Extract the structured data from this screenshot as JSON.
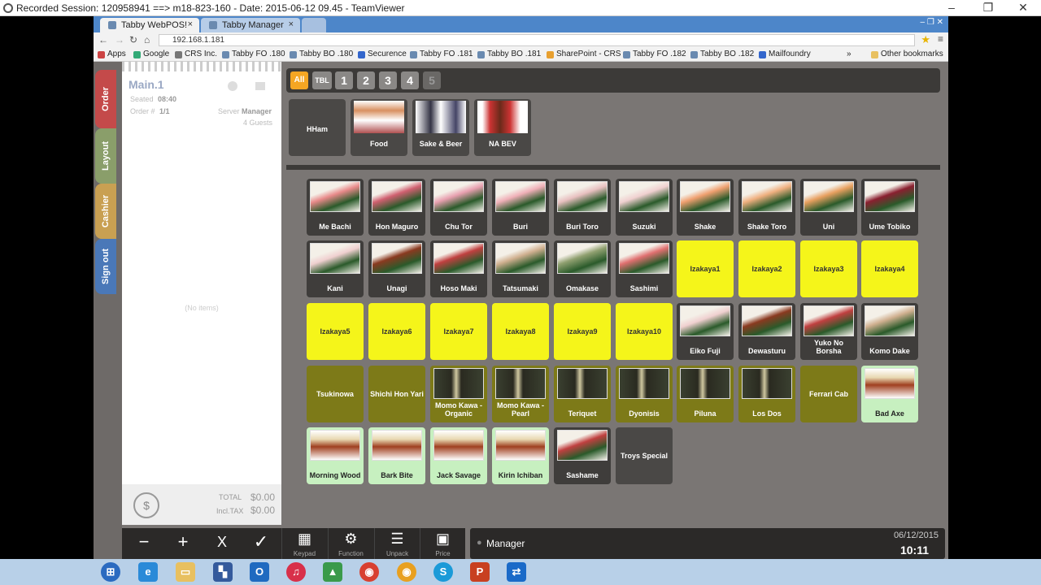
{
  "teamviewer": {
    "title": "Recorded Session: 120958941 ==> m18-823-160 - Date: 2015-06-12 09.45 - TeamViewer"
  },
  "browser": {
    "tabs": [
      {
        "label": "Tabby WebPOS!"
      },
      {
        "label": "Tabby Manager"
      }
    ],
    "url": "192.168.1.181",
    "bookmarks": [
      "Apps",
      "Google",
      "CRS Inc.",
      "Tabby FO .180",
      "Tabby BO .180",
      "Securence",
      "Tabby FO .181",
      "Tabby BO .181",
      "SharePoint - CRS",
      "Tabby FO .182",
      "Tabby BO .182",
      "Mailfoundry"
    ],
    "more_bookmarks": "»",
    "other_bookmarks": "Other bookmarks"
  },
  "sidebar": {
    "tabs": [
      {
        "label": "Order",
        "color": "#c44a4a"
      },
      {
        "label": "Layout",
        "color": "#8a9e6a"
      },
      {
        "label": "Cashier",
        "color": "#c9a052"
      },
      {
        "label": "Sign out",
        "color": "#4a78b8"
      }
    ]
  },
  "ticket": {
    "name": "Main.1",
    "seated_label": "Seated",
    "seated_value": "08:40",
    "order_label": "Order #",
    "order_value": "1/1",
    "server_label": "Server",
    "server_value": "Manager",
    "guests": "4 Guests",
    "empty": "(No items)",
    "total_label": "TOTAL",
    "total_value": "$0.00",
    "tax_label": "Incl.TAX",
    "tax_value": "$0.00"
  },
  "filters": [
    "All",
    "TBL",
    "1",
    "2",
    "3",
    "4",
    "5"
  ],
  "categories": [
    {
      "label": "HHam"
    },
    {
      "label": "Food"
    },
    {
      "label": "Sake & Beer"
    },
    {
      "label": "NA BEV"
    }
  ],
  "items": [
    {
      "label": "Me Bachi",
      "style": "img"
    },
    {
      "label": "Hon Maguro",
      "style": "img"
    },
    {
      "label": "Chu Tor",
      "style": "img"
    },
    {
      "label": "Buri",
      "style": "img"
    },
    {
      "label": "Buri Toro",
      "style": "img"
    },
    {
      "label": "Suzuki",
      "style": "img"
    },
    {
      "label": "Shake",
      "style": "img"
    },
    {
      "label": "Shake Toro",
      "style": "img"
    },
    {
      "label": "Uni",
      "style": "img"
    },
    {
      "label": "Ume Tobiko",
      "style": "img"
    },
    {
      "label": "Kani",
      "style": "img"
    },
    {
      "label": "Unagi",
      "style": "img"
    },
    {
      "label": "Hoso Maki",
      "style": "img"
    },
    {
      "label": "Tatsumaki",
      "style": "img"
    },
    {
      "label": "Omakase",
      "style": "img"
    },
    {
      "label": "Sashimi",
      "style": "img"
    },
    {
      "label": "Izakaya1",
      "style": "yellow"
    },
    {
      "label": "Izakaya2",
      "style": "yellow"
    },
    {
      "label": "Izakaya3",
      "style": "yellow"
    },
    {
      "label": "Izakaya4",
      "style": "yellow"
    },
    {
      "label": "Izakaya5",
      "style": "yellow"
    },
    {
      "label": "Izakaya6",
      "style": "yellow"
    },
    {
      "label": "Izakaya7",
      "style": "yellow"
    },
    {
      "label": "Izakaya8",
      "style": "yellow"
    },
    {
      "label": "Izakaya9",
      "style": "yellow"
    },
    {
      "label": "Izakaya10",
      "style": "yellow"
    },
    {
      "label": "Eiko Fuji",
      "style": "img"
    },
    {
      "label": "Dewasturu",
      "style": "img"
    },
    {
      "label": "Yuko No Borsha",
      "style": "img"
    },
    {
      "label": "Komo Dake",
      "style": "img"
    },
    {
      "label": "Tsukinowa",
      "style": "olive"
    },
    {
      "label": "Shichi Hon Yari",
      "style": "olive"
    },
    {
      "label": "Momo Kawa - Organic",
      "style": "olive-img"
    },
    {
      "label": "Momo Kawa - Pearl",
      "style": "olive-img"
    },
    {
      "label": "Teriquet",
      "style": "olive-img"
    },
    {
      "label": "Dyonisis",
      "style": "olive-img"
    },
    {
      "label": "Piluna",
      "style": "olive-img"
    },
    {
      "label": "Los Dos",
      "style": "olive-img"
    },
    {
      "label": "Ferrari Cab",
      "style": "olive"
    },
    {
      "label": "Bad Axe",
      "style": "mint-img"
    },
    {
      "label": "Morning Wood",
      "style": "mint-img"
    },
    {
      "label": "Bark Bite",
      "style": "mint-img"
    },
    {
      "label": "Jack Savage",
      "style": "mint-img"
    },
    {
      "label": "Kirin Ichiban",
      "style": "mint-img"
    },
    {
      "label": "Sashame",
      "style": "img"
    },
    {
      "label": "Troys Special",
      "style": "gray"
    }
  ],
  "toolbar": {
    "minus": "−",
    "plus": "+",
    "cancel": "X",
    "confirm": "✓",
    "keypad": "Keypad",
    "function": "Function",
    "unpack": "Unpack",
    "price": "Price"
  },
  "status": {
    "user": "Manager",
    "date": "06/12/2015",
    "time": "10:11"
  },
  "colors": {
    "accent": "#f5a623",
    "yellow": "#f5f51a",
    "olive": "#7d7a18",
    "mint": "#c7f0c0"
  }
}
